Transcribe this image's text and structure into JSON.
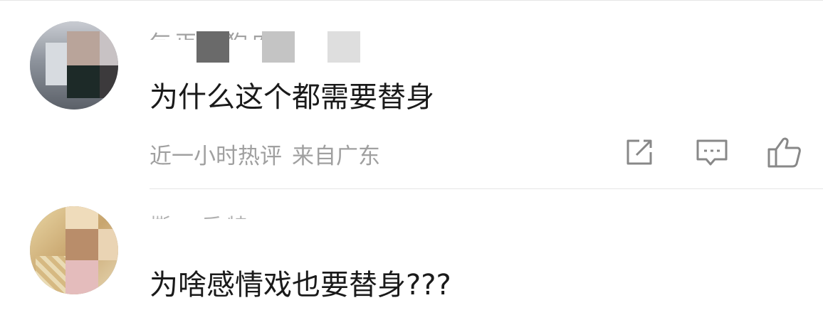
{
  "comments": [
    {
      "username": "乞丐吃狗肉",
      "text": "为什么这个都需要替身",
      "time": "近一小时热评",
      "location": "来自广东",
      "actions": [
        "share-icon",
        "comment-icon",
        "like-icon"
      ]
    },
    {
      "username": "撕二乐特",
      "text": "为啥感情戏也要替身???"
    }
  ],
  "colors": {
    "text": "#1a1a1a",
    "meta": "#a0a0a0",
    "icon": "#888888",
    "divider": "#e6e6e6"
  }
}
